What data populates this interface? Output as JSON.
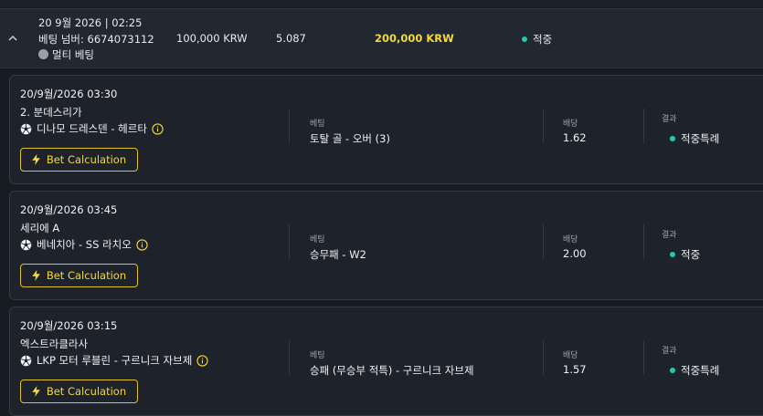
{
  "header": {
    "datetime": "20 9월 2026 | 02:25",
    "bet_number": "베팅 넘버: 6674073112",
    "bet_type": "멀티 베팅",
    "stake": "100,000 KRW",
    "odds": "5.087",
    "payout": "200,000 KRW",
    "status": "적중",
    "status_color": "#20c9b0"
  },
  "labels": {
    "bet": "베팅",
    "odds": "배당",
    "result": "결과",
    "calc_button": "Bet Calculation"
  },
  "selections": [
    {
      "datetime": "20/9월/2026 03:30",
      "league": "2. 분데스리가",
      "match": "디나모 드레스덴 - 헤르타",
      "market": "토탈 골 - 오버 (3)",
      "odds": "1.62",
      "result": "적중특례"
    },
    {
      "datetime": "20/9월/2026 03:45",
      "league": "세리에 A",
      "match": "베네치아 - SS 라치오",
      "market": "승무패 - W2",
      "odds": "2.00",
      "result": "적중"
    },
    {
      "datetime": "20/9월/2026 03:15",
      "league": "엑스트라클라사",
      "match": "LKP 모터 루블린 - 구르니크 자브제",
      "market": "승패 (무승부 적특) - 구르니크 자브제",
      "odds": "1.57",
      "result": "적중특례"
    }
  ],
  "accent_color": "#f3d93a"
}
